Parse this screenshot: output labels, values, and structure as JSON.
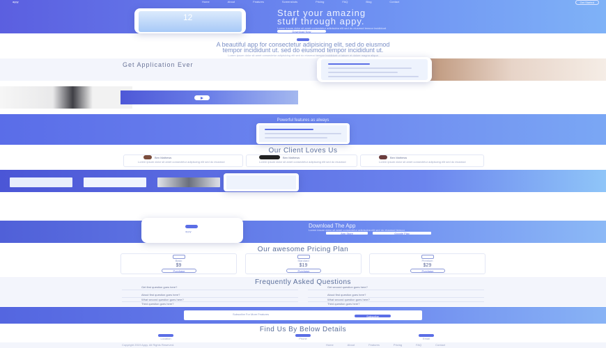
{
  "nav": {
    "brand": "appy",
    "items": [
      "Home",
      "About",
      "Features",
      "Screenshots",
      "Pricing",
      "FAQ",
      "Blog",
      "Contact"
    ],
    "button": "Get Started"
  },
  "hero": {
    "title_line1": "Start your amazing",
    "title_line2": "stuff through appy.",
    "subtitle": "Lorem ipsum dolor sit amet consectetur adipiscing elit sed do eiusmod tempor incididunt",
    "button": "Download Now",
    "clock": "12"
  },
  "intro": {
    "headline_line1": "A beautiful app for consectetur adipisicing elit, sed do eiusmod",
    "headline_line2": "tempor incididunt ut. sed do eiusmod tempor incididunt ut.",
    "body": "Lorem ipsum dolor sit amet consectetur adipisicing elit sed do eiusmod tempor incididunt ut labore et dolore magna aliqua"
  },
  "about": {
    "title": "Get Application Ever"
  },
  "features": {
    "title": "Powerful features as always"
  },
  "testimonials": {
    "title": "Our Client Loves Us",
    "items": [
      {
        "name": "Ben Mathews",
        "text": "Lorem ipsum dolor sit amet consectetur adipiscing elit sed do eiusmod"
      },
      {
        "name": "Ben Mathews",
        "text": "Lorem ipsum dolor sit amet consectetur adipiscing elit sed do eiusmod"
      },
      {
        "name": "Ben Mathews",
        "text": "Lorem ipsum dolor sit amet consectetur adipiscing elit sed do eiusmod"
      }
    ]
  },
  "download": {
    "title": "Download The App",
    "text": "Lorem ipsum dolor sit amet consectetur adipiscing elit sed do eiusmod tempor",
    "store1": "App Store",
    "store2": "Google Play",
    "logo": "appy"
  },
  "pricing": {
    "title": "Our awesome Pricing Plan",
    "plans": [
      {
        "name": "Basic",
        "price": "$9",
        "button": "Purchase"
      },
      {
        "name": "Standard",
        "price": "$19",
        "button": "Purchase"
      },
      {
        "name": "Premium",
        "price": "$29",
        "button": "Purchase"
      }
    ]
  },
  "faq": {
    "title": "Frequently Asked Questions",
    "left": [
      "Get first question goes here?",
      "About first question goes here?",
      "What second question goes here?",
      "Third question goes here?"
    ],
    "right": [
      "Get second question goes here?",
      "About first question goes here?",
      "What second question goes here?",
      "Third question goes here?"
    ]
  },
  "subscribe": {
    "label": "Subscribe For More Features",
    "button": "Subscribe"
  },
  "contact": {
    "title": "Find Us By Below Details",
    "items": [
      "Location",
      "Phone",
      "Email"
    ]
  },
  "footer": {
    "copyright": "Copyright 2019 Appy. All Rights Reserved.",
    "links": [
      "Home",
      "About",
      "Features",
      "Pricing",
      "FAQ",
      "Contact"
    ]
  },
  "colors": {
    "primary": "#5b6ee6",
    "light": "#8cb6f6",
    "bg_light": "#f3f5fc"
  }
}
